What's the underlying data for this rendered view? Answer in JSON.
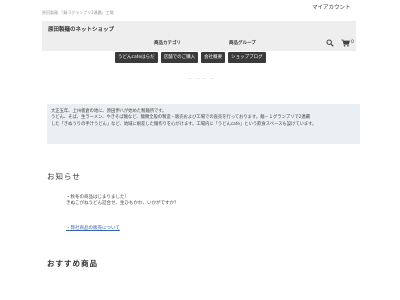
{
  "topbar": {
    "tagline": "原田製麺 「麺-1グランプリ2連覇」工場",
    "account_label": "マイアカウント"
  },
  "header": {
    "shop_name": "原田製麺のネットショップ",
    "nav_category": "商品カテゴリ",
    "nav_group": "商品グループ",
    "cart_count": "0"
  },
  "nav_buttons": [
    "うどんcafeはらだ",
    "店舗でのご購入",
    "会社概要",
    "ショップブログ"
  ],
  "divider_text": "— — — —",
  "intro": {
    "line1": "大正五年、上州板倉の地に、原田伊八が始めた製麺所です。",
    "line2": "うどん、そば、生ラーメン、やきそば麺など、麺類全般の製造・販売および工場での直売を行っております。麺－１グランプリで2連覇",
    "line3": "した「きぬうりの手汁うどん」など、地域に根差した麺作りを心がけます。工場内に「うどんcafe」という飲食スペースも設けています。"
  },
  "news": {
    "heading": "お知らせ",
    "line1": "・秋冬の商品はじまりました！",
    "line2": "きぬこがねうどん詰合せ、生ひもかわ、いかがですか？",
    "link": "・弊社商品の販売について"
  },
  "recommended": {
    "heading": "おすすめ商品"
  },
  "icons": {
    "search": "search-icon",
    "cart": "cart-icon"
  }
}
